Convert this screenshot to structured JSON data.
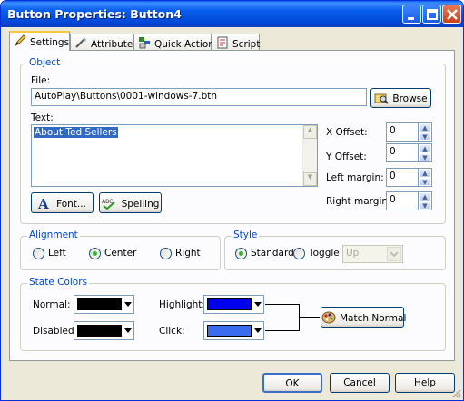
{
  "window": {
    "title": "Button Properties: Button4"
  },
  "tabs": [
    {
      "label": "Settings"
    },
    {
      "label": "Attributes"
    },
    {
      "label": "Quick Action"
    },
    {
      "label": "Script"
    }
  ],
  "object": {
    "group_label": "Object",
    "file_label": "File:",
    "file_value": "AutoPlay\\Buttons\\0001-windows-7.btn",
    "browse_label": "Browse",
    "text_label": "Text:",
    "text_value": "About Ted Sellers",
    "x_offset_label": "X Offset:",
    "x_offset_value": "0",
    "y_offset_label": "Y Offset:",
    "y_offset_value": "0",
    "left_margin_label": "Left margin:",
    "left_margin_value": "0",
    "right_margin_label": "Right margin:",
    "right_margin_value": "0",
    "font_label": "Font...",
    "spelling_label": "Spelling"
  },
  "alignment": {
    "group_label": "Alignment",
    "options": [
      "Left",
      "Center",
      "Right"
    ],
    "selected": "Center"
  },
  "style": {
    "group_label": "Style",
    "options": [
      "Standard",
      "Toggle"
    ],
    "selected": "Standard",
    "toggle_state_value": "Up"
  },
  "state_colors": {
    "group_label": "State Colors",
    "normal_label": "Normal:",
    "normal_color": "#000000",
    "disabled_label": "Disabled:",
    "disabled_color": "#000000",
    "highlight_label": "Highlight:",
    "highlight_color": "#0000ee",
    "click_label": "Click:",
    "click_color": "#3a6cf0",
    "match_normal_label": "Match Normal"
  },
  "footer": {
    "ok_label": "OK",
    "cancel_label": "Cancel",
    "help_label": "Help"
  }
}
